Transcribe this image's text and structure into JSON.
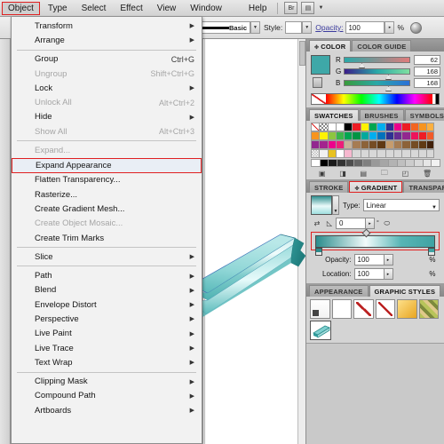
{
  "menubar": {
    "items": [
      {
        "label": "Object",
        "active": true
      },
      {
        "label": "Type",
        "active": false
      },
      {
        "label": "Select",
        "active": false
      },
      {
        "label": "Effect",
        "active": false
      },
      {
        "label": "View",
        "active": false
      },
      {
        "label": "Window",
        "active": false
      },
      {
        "label": "Help",
        "active": false
      }
    ],
    "icons": [
      "bridge-icon",
      "arrange-documents-icon",
      "chevron-down-icon"
    ]
  },
  "options_bar": {
    "stroke_profile_label": "Basic",
    "style_label": "Style:",
    "opacity_label": "Opacity:",
    "opacity_value": "100",
    "percent": "%"
  },
  "object_menu": {
    "title": "Object",
    "groups": [
      [
        {
          "label": "Transform",
          "accel": "",
          "submenu": true,
          "disabled": false,
          "highlight": false
        },
        {
          "label": "Arrange",
          "accel": "",
          "submenu": true,
          "disabled": false,
          "highlight": false
        }
      ],
      [
        {
          "label": "Group",
          "accel": "Ctrl+G",
          "submenu": false,
          "disabled": false,
          "highlight": false
        },
        {
          "label": "Ungroup",
          "accel": "Shift+Ctrl+G",
          "submenu": false,
          "disabled": true,
          "highlight": false
        },
        {
          "label": "Lock",
          "accel": "",
          "submenu": true,
          "disabled": false,
          "highlight": false
        },
        {
          "label": "Unlock All",
          "accel": "Alt+Ctrl+2",
          "submenu": false,
          "disabled": true,
          "highlight": false
        },
        {
          "label": "Hide",
          "accel": "",
          "submenu": true,
          "disabled": false,
          "highlight": false
        },
        {
          "label": "Show All",
          "accel": "Alt+Ctrl+3",
          "submenu": false,
          "disabled": true,
          "highlight": false
        }
      ],
      [
        {
          "label": "Expand...",
          "accel": "",
          "submenu": false,
          "disabled": true,
          "highlight": false
        },
        {
          "label": "Expand Appearance",
          "accel": "",
          "submenu": false,
          "disabled": false,
          "highlight": true
        },
        {
          "label": "Flatten Transparency...",
          "accel": "",
          "submenu": false,
          "disabled": false,
          "highlight": false
        },
        {
          "label": "Rasterize...",
          "accel": "",
          "submenu": false,
          "disabled": false,
          "highlight": false
        },
        {
          "label": "Create Gradient Mesh...",
          "accel": "",
          "submenu": false,
          "disabled": false,
          "highlight": false
        },
        {
          "label": "Create Object Mosaic...",
          "accel": "",
          "submenu": false,
          "disabled": true,
          "highlight": false
        },
        {
          "label": "Create Trim Marks",
          "accel": "",
          "submenu": false,
          "disabled": false,
          "highlight": false
        }
      ],
      [
        {
          "label": "Slice",
          "accel": "",
          "submenu": true,
          "disabled": false,
          "highlight": false
        }
      ],
      [
        {
          "label": "Path",
          "accel": "",
          "submenu": true,
          "disabled": false,
          "highlight": false
        },
        {
          "label": "Blend",
          "accel": "",
          "submenu": true,
          "disabled": false,
          "highlight": false
        },
        {
          "label": "Envelope Distort",
          "accel": "",
          "submenu": true,
          "disabled": false,
          "highlight": false
        },
        {
          "label": "Perspective",
          "accel": "",
          "submenu": true,
          "disabled": false,
          "highlight": false
        },
        {
          "label": "Live Paint",
          "accel": "",
          "submenu": true,
          "disabled": false,
          "highlight": false
        },
        {
          "label": "Live Trace",
          "accel": "",
          "submenu": true,
          "disabled": false,
          "highlight": false
        },
        {
          "label": "Text Wrap",
          "accel": "",
          "submenu": true,
          "disabled": false,
          "highlight": false
        }
      ],
      [
        {
          "label": "Clipping Mask",
          "accel": "",
          "submenu": true,
          "disabled": false,
          "highlight": false
        },
        {
          "label": "Compound Path",
          "accel": "",
          "submenu": true,
          "disabled": false,
          "highlight": false
        },
        {
          "label": "Artboards",
          "accel": "",
          "submenu": true,
          "disabled": false,
          "highlight": false
        }
      ]
    ]
  },
  "color_panel": {
    "tabs": [
      {
        "label": "COLOR",
        "selected": true
      },
      {
        "label": "COLOR GUIDE",
        "selected": false
      }
    ],
    "fill_color": "#3ea8a8",
    "channels": [
      {
        "name": "R",
        "value": "62"
      },
      {
        "name": "G",
        "value": "168"
      },
      {
        "name": "B",
        "value": "168"
      }
    ]
  },
  "swatches_panel": {
    "tabs": [
      {
        "label": "SWATCHES",
        "selected": true
      },
      {
        "label": "BRUSHES",
        "selected": false
      },
      {
        "label": "SYMBOLS",
        "selected": false
      }
    ],
    "rows": [
      [
        "#ffffff",
        "#ffffff",
        "#ffffff",
        "#ffffff",
        "#000000",
        "#ed1c24",
        "#fff200",
        "#00a651",
        "#00aeef",
        "#2e3192",
        "#ec008c",
        "#ed1c24",
        "#f26522",
        "#f7941e",
        "#fbb040"
      ],
      [
        "#f7941e",
        "#fff200",
        "#8dc63f",
        "#39b54a",
        "#00a651",
        "#009444",
        "#00a99d",
        "#00aeef",
        "#0072bc",
        "#2e3192",
        "#662d91",
        "#92278f",
        "#ed145b",
        "#ee1c25",
        "#f15a29"
      ],
      [
        "#92278f",
        "#a3238e",
        "#ec008c",
        "#ed1e79",
        "#c7b299",
        "#a67c52",
        "#8c6239",
        "#754c24",
        "#603913",
        "#c69c6d",
        "#a67c52",
        "#8c6239",
        "#754c24",
        "#603913",
        "#42210b"
      ],
      [
        "#cccccc",
        "#f1f1f1",
        "#e8c220",
        "#ffffff",
        "#f6b8cf",
        "#d8d8d8",
        "#d8d8d8",
        "#d8d8d8",
        "#d8d8d8",
        "#d8d8d8",
        "#d8d8d8",
        "#d8d8d8",
        "#d8d8d8",
        "#d8d8d8",
        "#d8d8d8"
      ]
    ],
    "gray_ramp": [
      "#ffffff",
      "#000000",
      "#1a1a1a",
      "#333333",
      "#4d4d4d",
      "#666666",
      "#808080",
      "#999999",
      "#a6a6a6",
      "#b3b3b3",
      "#bfbfbf",
      "#cccccc",
      "#d9d9d9",
      "#e6e6e6",
      "#f2f2f2"
    ],
    "toolbar_icons": [
      "swatch-library-icon",
      "show-swatch-kinds-icon",
      "swatch-options-icon",
      "new-color-group-icon",
      "new-swatch-icon",
      "delete-swatch-icon"
    ]
  },
  "gradient_panel": {
    "tabs": [
      {
        "label": "STROKE",
        "selected": false
      },
      {
        "label": "GRADIENT",
        "selected": true
      },
      {
        "label": "TRANSPAR",
        "selected": false
      }
    ],
    "type_label": "Type:",
    "type_value": "Linear",
    "angle_value": "0",
    "degree_symbol": "°",
    "opacity_label": "Opacity:",
    "opacity_value": "100",
    "location_label": "Location:",
    "location_value": "100",
    "percent": "%",
    "ramp_stops": [
      {
        "position": 0,
        "color": "#2b8c8c"
      },
      {
        "position": 42,
        "color": "#f2fbfb"
      },
      {
        "position": 100,
        "color": "#3fa3a3"
      }
    ]
  },
  "graphic_styles_panel": {
    "tabs": [
      {
        "label": "APPEARANCE",
        "selected": false
      },
      {
        "label": "GRAPHIC STYLES",
        "selected": true
      }
    ],
    "styles": [
      {
        "name": "default-style",
        "kind": "plain"
      },
      {
        "name": "none-style",
        "kind": "blank"
      },
      {
        "name": "no-fill-style",
        "kind": "slash"
      },
      {
        "name": "no-stroke-style",
        "kind": "slash2"
      },
      {
        "name": "yellow-gradient-style",
        "kind": "yellow"
      },
      {
        "name": "texture-style",
        "kind": "texture"
      },
      {
        "name": "teal-3d-style",
        "kind": "teal3d"
      }
    ]
  },
  "artwork": {
    "name": "teal-3d-extruded-shape",
    "colors": {
      "top_face": "#7fd0d0",
      "side_face": "#2f9b9b",
      "highlight": "#e8fbfb",
      "edge": "#2f6fb5"
    }
  }
}
